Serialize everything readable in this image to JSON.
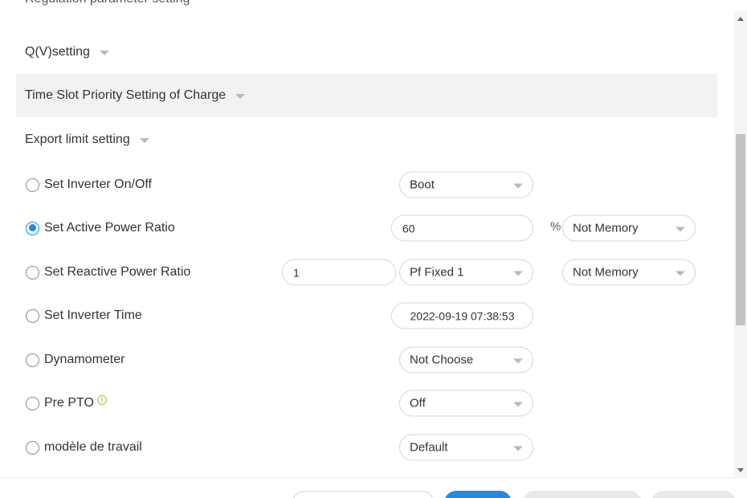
{
  "sections": {
    "regulation": "Regulation parameter setting",
    "qv": "Q(V)setting",
    "timeslot": "Time Slot Priority Setting of Charge",
    "export_limit": "Export limit setting"
  },
  "rows": {
    "inverter_onoff": {
      "label": "Set Inverter On/Off",
      "select": "Boot",
      "checked": false
    },
    "active_power": {
      "label": "Set Active Power Ratio",
      "value": "60",
      "unit": "%",
      "memory": "Not Memory",
      "checked": true
    },
    "reactive_power": {
      "label": "Set Reactive Power Ratio",
      "value": "1",
      "mode": "Pf Fixed 1",
      "memory": "Not Memory",
      "checked": false
    },
    "inverter_time": {
      "label": "Set Inverter Time",
      "value": "2022-09-19 07:38:53",
      "checked": false
    },
    "dynamometer": {
      "label": "Dynamometer",
      "select": "Not Choose",
      "checked": false
    },
    "pre_pto": {
      "label": "Pre PTO",
      "info_icon": "!",
      "select": "Off",
      "checked": false
    },
    "work_mode": {
      "label": "modèle de travail",
      "select": "Default",
      "checked": false
    }
  },
  "colors": {
    "accent": "#1e8be6",
    "info": "#9bc53d",
    "highlight_bg": "#f2f2f2"
  },
  "icons": [
    "radio-icon",
    "chevron-down-icon",
    "info-icon",
    "scroll-up-icon",
    "scroll-down-icon"
  ]
}
